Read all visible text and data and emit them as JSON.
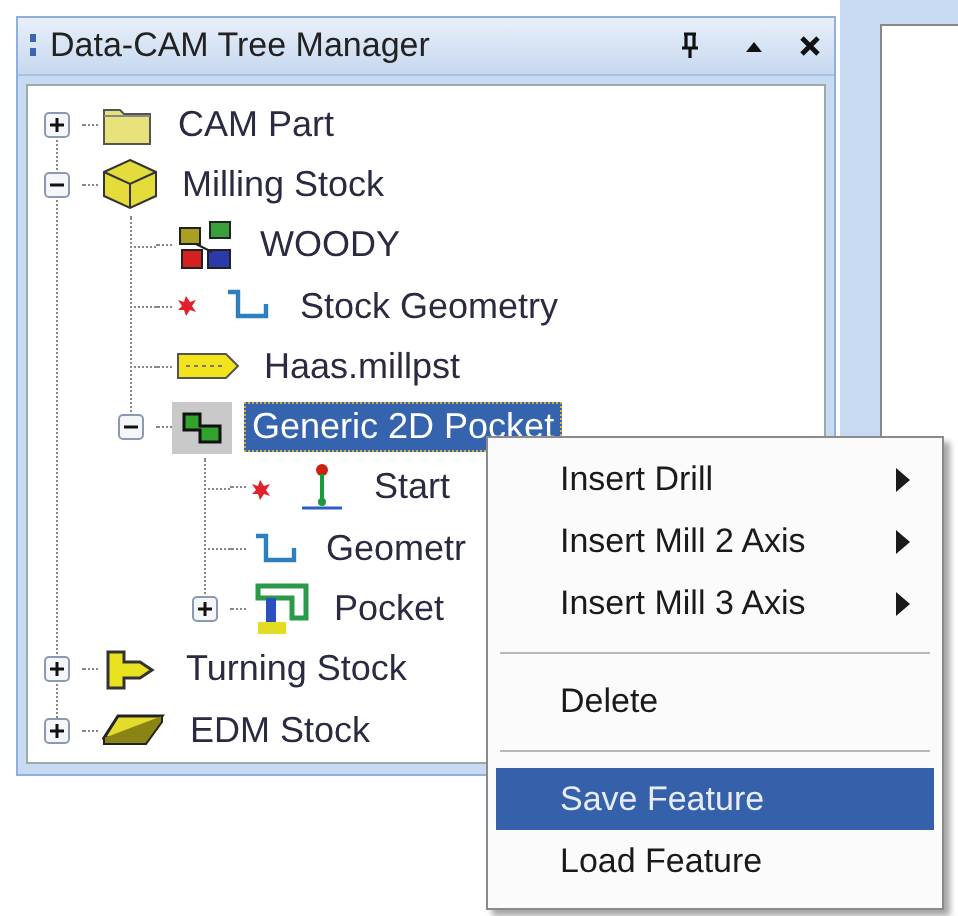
{
  "window": {
    "title": "Data-CAM Tree Manager"
  },
  "tree": [
    {
      "label": "CAM Part",
      "expanded": false,
      "selected": false
    },
    {
      "label": "Milling Stock",
      "expanded": true,
      "selected": false,
      "children": [
        {
          "label": "WOODY",
          "selected": false
        },
        {
          "label": "Stock Geometry",
          "selected": false
        },
        {
          "label": "Haas.millpst",
          "selected": false
        },
        {
          "label": "Generic 2D Pocket",
          "expanded": true,
          "selected": true,
          "children": [
            {
              "label": "Start",
              "selected": false
            },
            {
              "label": "Geometr",
              "selected": false
            },
            {
              "label": "Pocket",
              "expanded": false,
              "selected": false
            }
          ]
        }
      ]
    },
    {
      "label": "Turning Stock",
      "expanded": false,
      "selected": false
    },
    {
      "label": "EDM Stock",
      "expanded": false,
      "selected": false
    }
  ],
  "context_menu": [
    {
      "kind": "item",
      "label": "Insert Drill",
      "submenu": true,
      "selected": false
    },
    {
      "kind": "item",
      "label": "Insert Mill 2 Axis",
      "submenu": true,
      "selected": false
    },
    {
      "kind": "item",
      "label": "Insert Mill 3 Axis",
      "submenu": true,
      "selected": false
    },
    {
      "kind": "separator"
    },
    {
      "kind": "item",
      "label": "Delete",
      "submenu": false,
      "selected": false
    },
    {
      "kind": "separator"
    },
    {
      "kind": "item",
      "label": "Save Feature",
      "submenu": false,
      "selected": true
    },
    {
      "kind": "item",
      "label": "Load Feature",
      "submenu": false,
      "selected": false
    }
  ]
}
